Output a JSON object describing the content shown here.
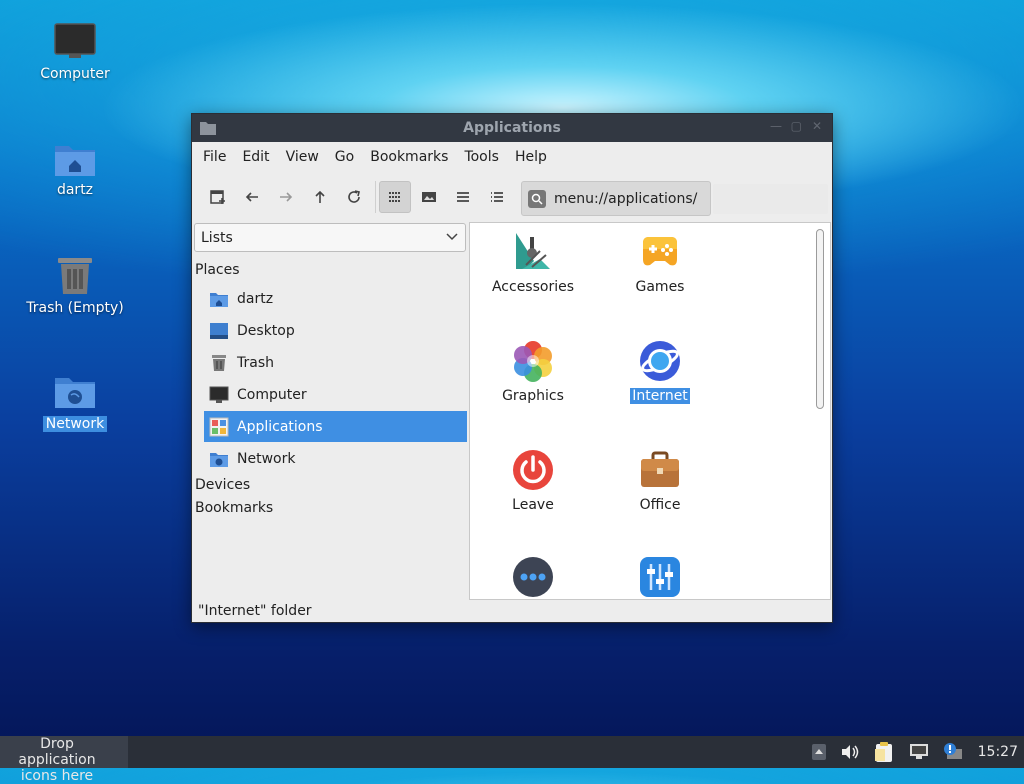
{
  "desktop": {
    "icons": [
      {
        "label": "Computer",
        "icon": "computer-icon"
      },
      {
        "label": "dartz",
        "icon": "home-folder-icon"
      },
      {
        "label": "Trash (Empty)",
        "icon": "trash-icon"
      },
      {
        "label": "Network",
        "icon": "network-folder-icon",
        "selected": true
      }
    ]
  },
  "window": {
    "title": "Applications",
    "menu": [
      "File",
      "Edit",
      "View",
      "Go",
      "Bookmarks",
      "Tools",
      "Help"
    ],
    "toolbar": {
      "buttons": [
        "new-tab-icon",
        "back-icon",
        "forward-icon",
        "up-icon",
        "reload-icon",
        "icon-view-icon",
        "thumbnail-view-icon",
        "compact-view-icon",
        "detailed-list-icon"
      ],
      "active_view": "icon-view-icon"
    },
    "location": "menu://applications/",
    "side_select": "Lists",
    "places_header": "Places",
    "places": [
      {
        "label": "dartz",
        "icon": "home-folder-icon"
      },
      {
        "label": "Desktop",
        "icon": "desktop-icon"
      },
      {
        "label": "Trash",
        "icon": "trash-icon"
      },
      {
        "label": "Computer",
        "icon": "computer-icon"
      },
      {
        "label": "Applications",
        "icon": "applications-icon",
        "active": true
      },
      {
        "label": "Network",
        "icon": "network-folder-icon"
      }
    ],
    "devices_header": "Devices",
    "bookmarks_header": "Bookmarks",
    "apps": [
      {
        "label": "Accessories",
        "icon": "accessories-icon"
      },
      {
        "label": "Games",
        "icon": "gamepad-icon"
      },
      {
        "label": "Graphics",
        "icon": "graphics-icon"
      },
      {
        "label": "Internet",
        "icon": "internet-icon",
        "selected": true
      },
      {
        "label": "Leave",
        "icon": "power-icon"
      },
      {
        "label": "Office",
        "icon": "briefcase-icon"
      },
      {
        "label": "",
        "icon": "other-icon"
      },
      {
        "label": "",
        "icon": "preferences-icon"
      }
    ],
    "status": "\"Internet\" folder"
  },
  "taskbar": {
    "drop_text_1": "Drop application",
    "drop_text_2": "icons here",
    "clock": "15:27",
    "tray": [
      "tray-up-arrow-icon",
      "volume-icon",
      "clipboard-icon",
      "network-status-icon",
      "update-notifier-icon"
    ]
  },
  "colors": {
    "selection": "#3f8fe3",
    "titlebar": "#323842",
    "taskbar": "#2a2f38"
  }
}
